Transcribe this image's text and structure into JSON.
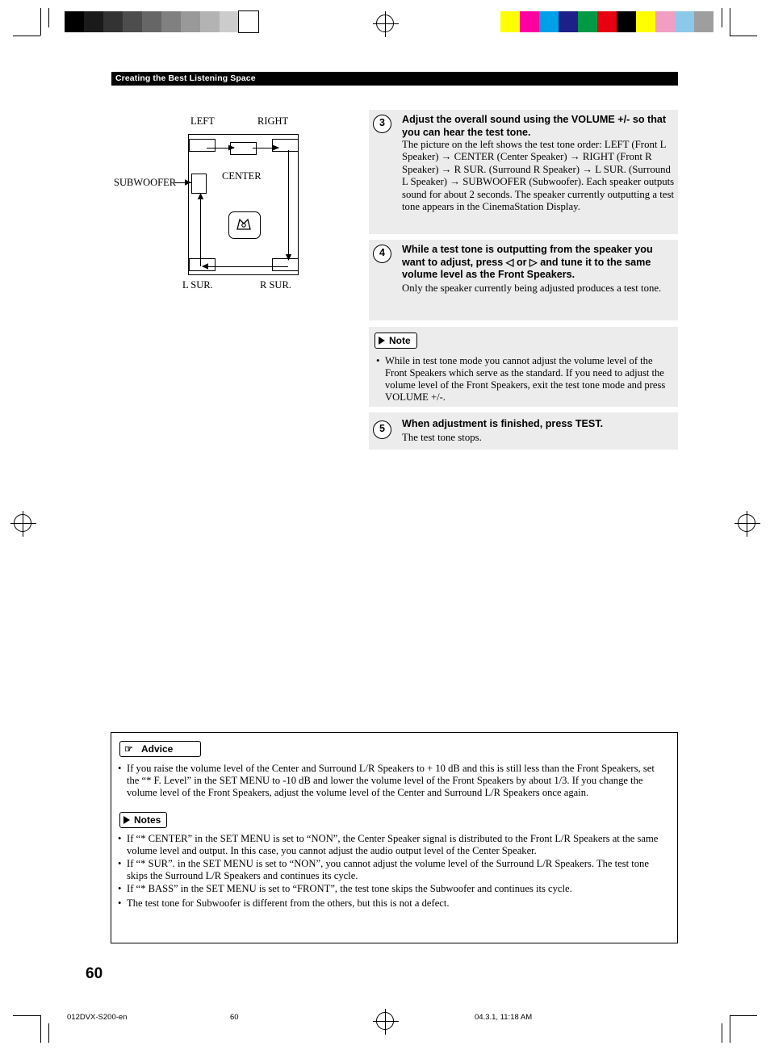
{
  "header": {
    "running_title": "Creating the Best Listening Space"
  },
  "diagram": {
    "labels": {
      "left": "LEFT",
      "right": "RIGHT",
      "subwoofer": "SUBWOOFER",
      "center": "CENTER",
      "l_sur": "L SUR.",
      "r_sur": "R SUR."
    },
    "tv_icon": "tv-icon"
  },
  "steps": [
    {
      "number": "3",
      "heading": "Adjust the overall sound using the VOLUME +/- so that you can hear the test tone.",
      "body": "The picture on the left shows the test tone order: LEFT (Front L Speaker) → CENTER (Center Speaker) → RIGHT (Front R Speaker) → R SUR. (Surround R Speaker) → L SUR. (Surround L Speaker) → SUBWOOFER (Subwoofer). Each speaker outputs sound for about 2 seconds. The speaker currently outputting a test tone appears in the CinemaStation Display."
    },
    {
      "number": "4",
      "heading": "While a test tone is outputting from the speaker you want to adjust, press ◁ or ▷ and tune it to the same volume level as the Front Speakers.",
      "body": "Only the speaker currently being adjusted produces a test tone."
    },
    {
      "number": "5",
      "heading": "When adjustment is finished, press TEST.",
      "body": "The test tone stops."
    }
  ],
  "note_box": {
    "badge": "Note",
    "items": [
      "While in test tone mode you cannot adjust the volume level of the Front Speakers which serve as the standard. If you need to adjust the volume level of the Front Speakers, exit the test tone mode and press VOLUME +/-."
    ]
  },
  "advice_box": {
    "advice_badge": "Advice",
    "advice_items": [
      "If you raise the volume level of the Center and Surround L/R Speakers to + 10 dB and this is still less than the Front Speakers, set the “* F. Level” in the SET MENU to -10 dB and lower the volume level of the Front Speakers by about 1/3. If you change the volume level of the Front Speakers, adjust the volume level of the Center and Surround L/R Speakers once again."
    ],
    "notes_badge": "Notes",
    "notes_items": [
      "If “* CENTER” in the SET MENU is set to “NON”, the Center Speaker signal is distributed to the Front L/R Speakers at the same volume level and output. In this case, you cannot adjust the audio output level of the Center Speaker.",
      "If “* SUR”. in the SET MENU is set to “NON”, you cannot adjust the volume level of the Surround L/R Speakers. The test tone skips the Surround L/R Speakers and continues its cycle.",
      "If “* BASS” in the SET MENU is set to “FRONT”, the test tone skips the Subwoofer and continues its cycle.",
      "The test tone for Subwoofer is different from the others, but this is not a defect."
    ]
  },
  "page_number": "60",
  "footer": {
    "file": "012DVX-S200-en",
    "page": "60",
    "timestamp": "04.3.1, 11:18 AM"
  },
  "color_bars": {
    "left": [
      "#000000",
      "#1a1a1a",
      "#333333",
      "#4d4d4d",
      "#666666",
      "#808080",
      "#999999",
      "#b3b3b3",
      "#cccccc",
      "#ffffff"
    ],
    "right": [
      "#ffff00",
      "#ff00a0",
      "#00a0e9",
      "#1d2088",
      "#009944",
      "#e60012",
      "#000000",
      "#ffff00",
      "#f19ec2",
      "#8cc8e8",
      "#9e9e9e"
    ]
  }
}
